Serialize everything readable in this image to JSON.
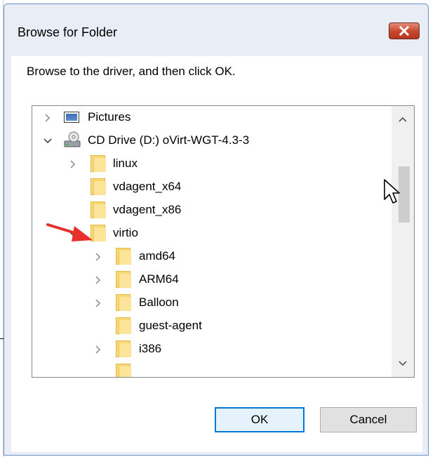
{
  "dialog": {
    "title": "Browse for Folder",
    "instruction": "Browse to the driver, and then click OK.",
    "ok_label": "OK",
    "cancel_label": "Cancel"
  },
  "tree": {
    "items": [
      {
        "label": "Pictures",
        "icon": "pictures-icon",
        "expander": "collapsed"
      },
      {
        "label": "CD Drive (D:) oVirt-WGT-4.3-3",
        "icon": "cd-drive-icon",
        "expander": "expanded"
      },
      {
        "label": "linux",
        "icon": "folder-icon",
        "expander": "collapsed"
      },
      {
        "label": "vdagent_x64",
        "icon": "folder-icon",
        "expander": "none"
      },
      {
        "label": "vdagent_x86",
        "icon": "folder-icon",
        "expander": "none"
      },
      {
        "label": "virtio",
        "icon": "folder-icon",
        "expander": "expanded"
      },
      {
        "label": "amd64",
        "icon": "folder-icon",
        "expander": "collapsed"
      },
      {
        "label": "ARM64",
        "icon": "folder-icon",
        "expander": "collapsed"
      },
      {
        "label": "Balloon",
        "icon": "folder-icon",
        "expander": "collapsed"
      },
      {
        "label": "guest-agent",
        "icon": "folder-icon",
        "expander": "none"
      },
      {
        "label": "i386",
        "icon": "folder-icon",
        "expander": "collapsed"
      }
    ]
  },
  "colors": {
    "close_button": "#c7452c",
    "ok_border": "#0078d7",
    "annotation_arrow": "#e8302a",
    "folder": "#f8d775"
  }
}
